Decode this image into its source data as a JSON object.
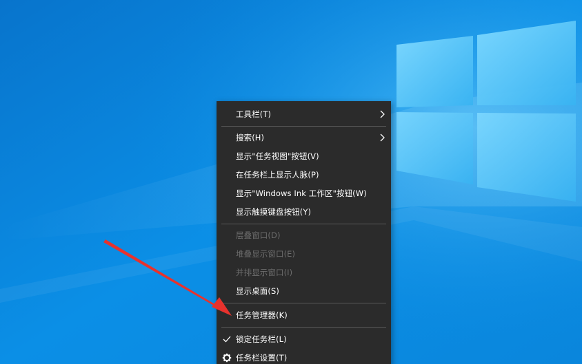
{
  "desktop": {
    "background_color": "#0b8ee8",
    "accent_color": "#5ecbff"
  },
  "context_menu": {
    "background_color": "#2b2b2b",
    "text_color": "#ffffff",
    "disabled_text_color": "#6d6d6d",
    "items": [
      {
        "label": "工具栏(T)",
        "has_submenu": true,
        "enabled": true
      },
      {
        "label": "搜索(H)",
        "has_submenu": true,
        "enabled": true
      },
      {
        "label": "显示\"任务视图\"按钮(V)",
        "has_submenu": false,
        "enabled": true
      },
      {
        "label": "在任务栏上显示人脉(P)",
        "has_submenu": false,
        "enabled": true
      },
      {
        "label": "显示\"Windows Ink 工作区\"按钮(W)",
        "has_submenu": false,
        "enabled": true
      },
      {
        "label": "显示触摸键盘按钮(Y)",
        "has_submenu": false,
        "enabled": true
      },
      {
        "label": "层叠窗口(D)",
        "has_submenu": false,
        "enabled": false
      },
      {
        "label": "堆叠显示窗口(E)",
        "has_submenu": false,
        "enabled": false
      },
      {
        "label": "并排显示窗口(I)",
        "has_submenu": false,
        "enabled": false
      },
      {
        "label": "显示桌面(S)",
        "has_submenu": false,
        "enabled": true
      },
      {
        "label": "任务管理器(K)",
        "has_submenu": false,
        "enabled": true
      },
      {
        "label": "锁定任务栏(L)",
        "has_submenu": false,
        "enabled": true,
        "checked": true,
        "icon": "checkmark-icon"
      },
      {
        "label": "任务栏设置(T)",
        "has_submenu": false,
        "enabled": true,
        "icon": "gear-icon"
      }
    ]
  },
  "annotation": {
    "arrow_color": "#e8322d",
    "points_to": "任务管理器(K)"
  }
}
